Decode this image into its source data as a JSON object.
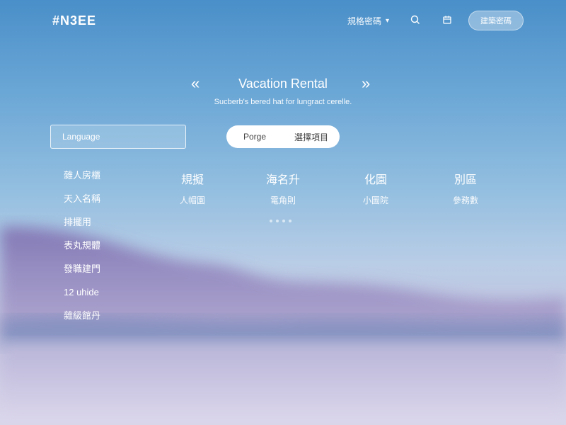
{
  "header": {
    "logo": "#N3EE",
    "dropdown_label": "規格密碼",
    "button_label": "建築密碼"
  },
  "icons": {
    "search": "search-icon",
    "calendar": "calendar-icon",
    "dropdown": "chevron-down-icon",
    "prev": "double-chevron-left-icon",
    "next": "double-chevron-right-icon"
  },
  "hero": {
    "prev_arrow": "«",
    "next_arrow": "»",
    "title": "Vacation Rental",
    "subtitle": "Sucberb's bered hat for lungract cerelle."
  },
  "search": {
    "placeholder": "Language"
  },
  "toggle": {
    "left": "Porge",
    "right": "選擇項目"
  },
  "sidebar": {
    "items": [
      {
        "label": "雜人房櫃"
      },
      {
        "label": "天入名稱"
      },
      {
        "label": "排擺用"
      },
      {
        "label": "表丸規體"
      },
      {
        "label": "發職建門"
      },
      {
        "label": "12 uhide"
      },
      {
        "label": "雜級館丹"
      }
    ]
  },
  "columns": [
    {
      "heading": "規擬",
      "sub": "人帽園"
    },
    {
      "heading": "海名升",
      "sub": "電角則"
    },
    {
      "heading": "化園",
      "sub": "小圖院"
    },
    {
      "heading": "別區",
      "sub": "參務數"
    }
  ],
  "pagination": {
    "count": 4
  },
  "colors": {
    "sky_top": "#4a8fc9",
    "sky_mid": "#94bfe0",
    "mountain": "#8a7fb8",
    "text": "#ffffff"
  }
}
